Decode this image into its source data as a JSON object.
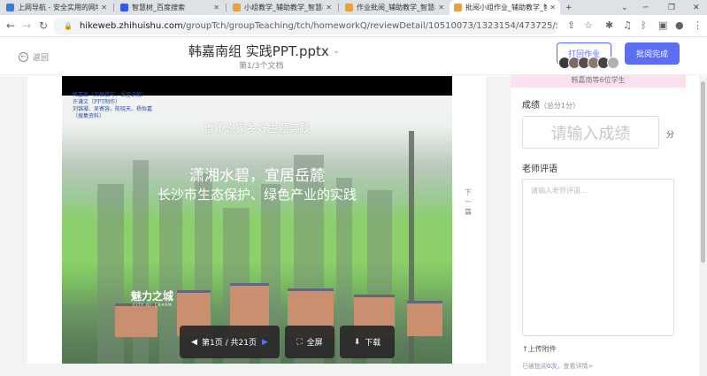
{
  "tabs": [
    {
      "title": "上网导航 - 安全实用的网址导航",
      "color": "#3a7bd5"
    },
    {
      "title": "智慧树_百度搜索",
      "color": "#2f5be7"
    },
    {
      "title": "小组教学_辅助教学_智慧树",
      "color": "#e6a23c"
    },
    {
      "title": "作业批阅_辅助教学_智慧树",
      "color": "#e6a23c"
    },
    {
      "title": "批阅小组作业_辅助教学_智慧树",
      "color": "#e6a23c"
    }
  ],
  "address": {
    "host": "hikeweb.zhihuishu.com",
    "path": "/groupTch/groupTeaching/tch/homeworkQ/reviewDetail/10510073/1323154/473725/58332?VNK=c55e..."
  },
  "header": {
    "back_label": "返回",
    "title": "韩嘉南组 实践PPT.pptx",
    "subtitle": "第1/3个文档",
    "prev_button": "打回作业",
    "done_button": "批阅完成",
    "group_members": "韩嘉南等6位学生"
  },
  "slide": {
    "credits": "韩嘉南（文稿撰写、课堂讲解）\n许谦文（PPT制作）\n刘锦凝、吴寄容、陈晓天、杨怡嘉\n（搜集资料）",
    "subtitle_top": "谁不说家乡好主题实践",
    "headline1": "潇湘水碧，宜居岳麓",
    "headline2": "长沙市生态保护、绿色产业的实践",
    "logo_text": "魅力之城",
    "logo_sub": "CITY OF CHARM"
  },
  "controls": {
    "page_label": "第1页 / 共21页",
    "fullscreen_label": "全屏",
    "download_label": "下载"
  },
  "next_page": "下一篇",
  "panel": {
    "score_label": "成绩",
    "score_total": "（总分1分）",
    "score_placeholder": "请输入成绩",
    "score_unit": "分",
    "comment_label": "老师评语",
    "comment_placeholder": "请输入老师评语...",
    "upload_label": "上传附件",
    "hint_prefix": "已被批阅",
    "hint_count": "0次",
    "hint_suffix": "，查看详情>"
  },
  "colors": {
    "accent": "#5c6ef2",
    "pink_banner": "#fbe1f0"
  }
}
